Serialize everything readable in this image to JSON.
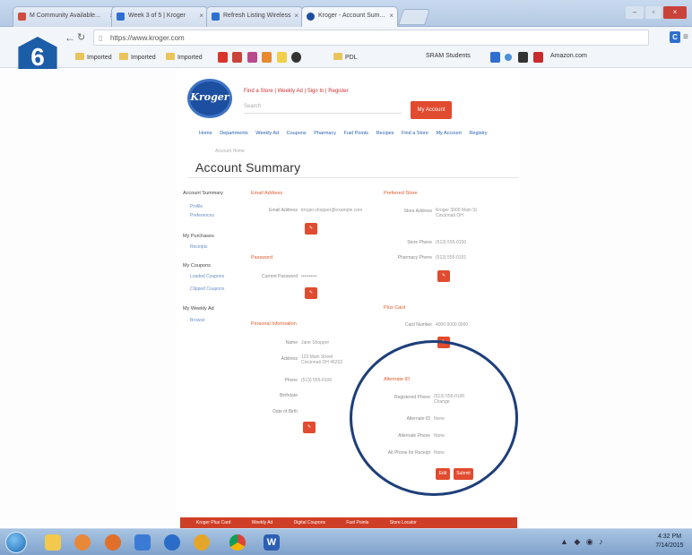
{
  "step_badge": "6",
  "browser": {
    "tabs": [
      {
        "label": "M Community Available...",
        "color": "#d14b3f"
      },
      {
        "label": "Week 3 of 5 | Kroger",
        "color": "#2e6fd0"
      },
      {
        "label": "Refresh Listing Wireless",
        "color": "#2e6fd0"
      },
      {
        "label": "Kroger - Account Sum...",
        "color": "#1d4fa0"
      }
    ],
    "url": "https://www.kroger.com",
    "bookmarks": [
      "Imported",
      "Imported",
      "Imported",
      "PDL",
      "SRAM Students",
      "Amazon.com"
    ]
  },
  "site": {
    "logo_text": "Kroger",
    "header_links": "Find a Store | Weekly Ad | Sign In | Register",
    "search_placeholder": "Search",
    "my_account_button": "My Account",
    "nav": [
      "Home",
      "Departments",
      "Weekly Ad",
      "Coupons",
      "Pharmacy",
      "Fuel Points",
      "Recipes",
      "Find a Store",
      "My Account",
      "Registry"
    ],
    "subnav": "Account Home",
    "page_title": "Account Summary",
    "sidebar": [
      {
        "label": "Account Summary",
        "sub": [
          "Profile",
          "Preferences"
        ]
      },
      {
        "label": "My Purchases",
        "sub": [
          "Receipts"
        ]
      },
      {
        "label": "My Coupons",
        "sub": [
          "Loaded Coupons",
          "Clipped Coupons"
        ]
      },
      {
        "label": "My Weekly Ad",
        "sub": [
          "Browse"
        ]
      }
    ],
    "sections": {
      "email_address": {
        "title": "Email Address",
        "label": "Email Address",
        "value": "kroger.shopper@example.com"
      },
      "password": {
        "title": "Password",
        "label": "Current Password",
        "value": "••••••••••"
      },
      "personal_information": {
        "title": "Personal Information",
        "rows": [
          {
            "label": "Name",
            "value": "Jane Shopper"
          },
          {
            "label": "Address",
            "value": "123 Main Street  Cincinnati OH 45202"
          },
          {
            "label": "Phone",
            "value": "(513) 555-0100"
          },
          {
            "label": "Birthdate",
            "value": ""
          },
          {
            "label": "Date of Birth",
            "value": ""
          }
        ]
      },
      "preferred_store": {
        "title": "Preferred Store",
        "rows": [
          {
            "label": "Store Address",
            "value": "Kroger  3000 Main St  Cincinnati OH"
          },
          {
            "label": "Store Phone",
            "value": "(513) 555-0150"
          },
          {
            "label": "Pharmacy Phone",
            "value": "(513) 555-0151"
          }
        ]
      },
      "plus_card": {
        "title": "Plus Card",
        "label": "Card Number",
        "value": "4000 0000 0000"
      },
      "alternate_id": {
        "title": "Alternate ID",
        "rows": [
          {
            "label": "Registered Phone",
            "value": "(513) 555-0100 Change"
          },
          {
            "label": "Alternate ID",
            "value": "None"
          },
          {
            "label": "Alternate Phone",
            "value": "None"
          },
          {
            "label": "Alt Phone for Receipt",
            "value": "None"
          }
        ],
        "edit_button": "Edit",
        "submit_button": "Submit"
      },
      "edit_button": "Edit"
    },
    "footer_links": [
      "Kroger Plus Card",
      "Weekly Ad",
      "Digital Coupons",
      "Fuel Points",
      "Store Locator"
    ]
  },
  "taskbar": {
    "tray_text": "▲ ◆ ◉ ♪",
    "clock_time": "4:32 PM",
    "clock_date": "7/14/2015"
  }
}
